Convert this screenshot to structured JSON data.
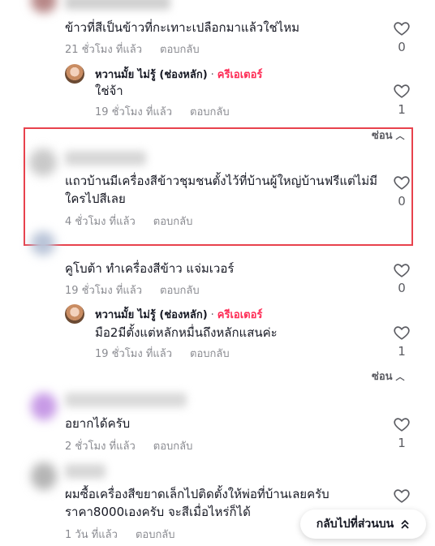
{
  "comments": [
    {
      "text": "ข้าวที่สีเป็นข้าวที่กะเทาะเปลือกมาแล้วใช่ไหม",
      "time": "21 ชั่วโมง ที่แล้ว",
      "reply_label": "ตอบกลับ",
      "likes": "0",
      "reply": {
        "author": "หวานมั้ย ไม่รู้ (ช่องหลัก)",
        "separator": "·",
        "badge": "ครีเอเตอร์",
        "text": "ใช่จ้า",
        "time": "19 ชั่วโมง ที่แล้ว",
        "reply_label": "ตอบกลับ",
        "likes": "1"
      },
      "hide_label": "ซ่อน"
    },
    {
      "text_line1": "แถวบ้านมีเครื่องสีข้าวชุมชนตั้งไว้ที่บ้านผู้ใหญ่บ้านฟรีแต่ไม่มี",
      "text_line2": "ใครไปสีเลย",
      "time": "4 ชั่วโมง ที่แล้ว",
      "reply_label": "ตอบกลับ",
      "likes": "0"
    },
    {
      "text": "คูโบต้า ทำเครื่องสีข้าว แจ่มเวอร์",
      "time": "19 ชั่วโมง ที่แล้ว",
      "reply_label": "ตอบกลับ",
      "likes": "0",
      "reply": {
        "author": "หวานมั้ย ไม่รู้ (ช่องหลัก)",
        "separator": "·",
        "badge": "ครีเอเตอร์",
        "text": "มือ2มีตั้งแต่หลักหมื่นถึงหลักแสนค่ะ",
        "time": "19 ชั่วโมง ที่แล้ว",
        "reply_label": "ตอบกลับ",
        "likes": "1"
      },
      "hide_label": "ซ่อน"
    },
    {
      "text": "อยากได้ครับ",
      "time": "2 ชั่วโมง ที่แล้ว",
      "reply_label": "ตอบกลับ",
      "likes": "1"
    },
    {
      "text_line1": "ผมซื้อเครื่องสีขยาดเล็กไปติดตั้งให้พ่อที่บ้านเลยครับ",
      "text_line2": "ราคา8000เองครับ จะสีเมื่อไหร่ก็ได้",
      "time": "1 วัน ที่แล้ว",
      "reply_label": "ตอบกลับ"
    }
  ],
  "back_to_top": {
    "label": "กลับไปที่ส่วนบน",
    "icon": "double-chevron-up-icon"
  },
  "colors": {
    "creator": "#fe2c55",
    "highlight": "#e8424d",
    "meta": "#8a8b91"
  }
}
